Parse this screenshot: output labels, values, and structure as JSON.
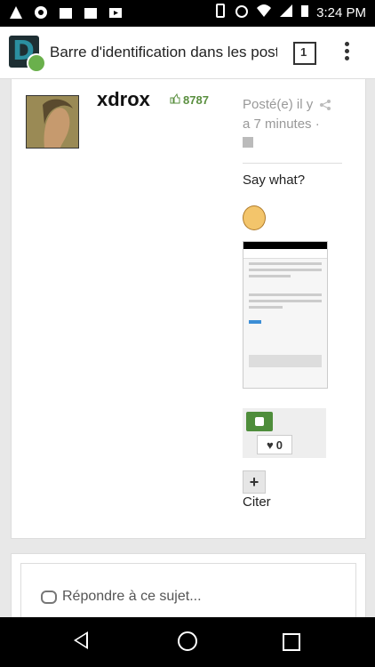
{
  "status": {
    "time": "3:24 PM"
  },
  "app": {
    "title": "Barre d'identification dans les posts",
    "tab_count": "1"
  },
  "post": {
    "author": "xdrox",
    "reputation": "8787",
    "meta_line1": "Posté(e) il y",
    "meta_line2": "a 7 minutes ·",
    "text": "Say what?",
    "heart_count": "0",
    "quote_label": "Citer"
  },
  "reply": {
    "placeholder": "Répondre à ce sujet..."
  }
}
